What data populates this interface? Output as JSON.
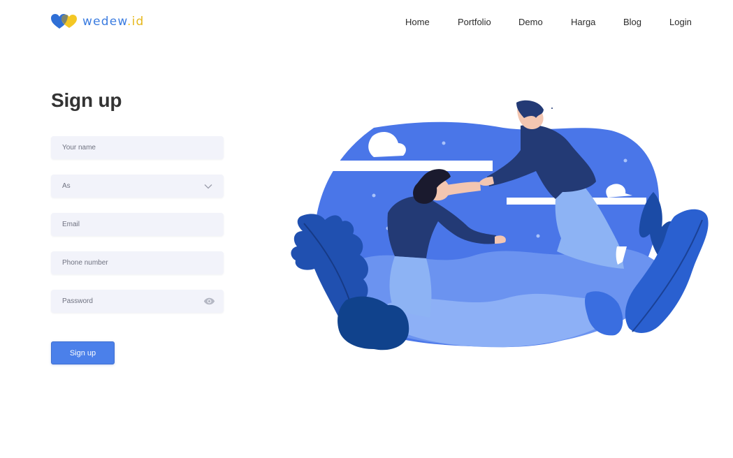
{
  "brand": {
    "name": "wedew",
    "dot": ".",
    "tld": "id",
    "logo_icon": "hearts-icon"
  },
  "nav": {
    "items": [
      "Home",
      "Portfolio",
      "Demo",
      "Harga",
      "Blog",
      "Login"
    ]
  },
  "form": {
    "title": "Sign up",
    "name_placeholder": "Your name",
    "role_selected": "As",
    "email_placeholder": "Email",
    "phone_placeholder": "Phone number",
    "password_placeholder": "Password",
    "submit_label": "Sign up"
  },
  "colors": {
    "accent": "#4b80ea",
    "brand_blue": "#3b7ce0",
    "brand_yellow": "#f3c623",
    "field_bg": "#f2f3fa",
    "navy": "#233a75"
  }
}
